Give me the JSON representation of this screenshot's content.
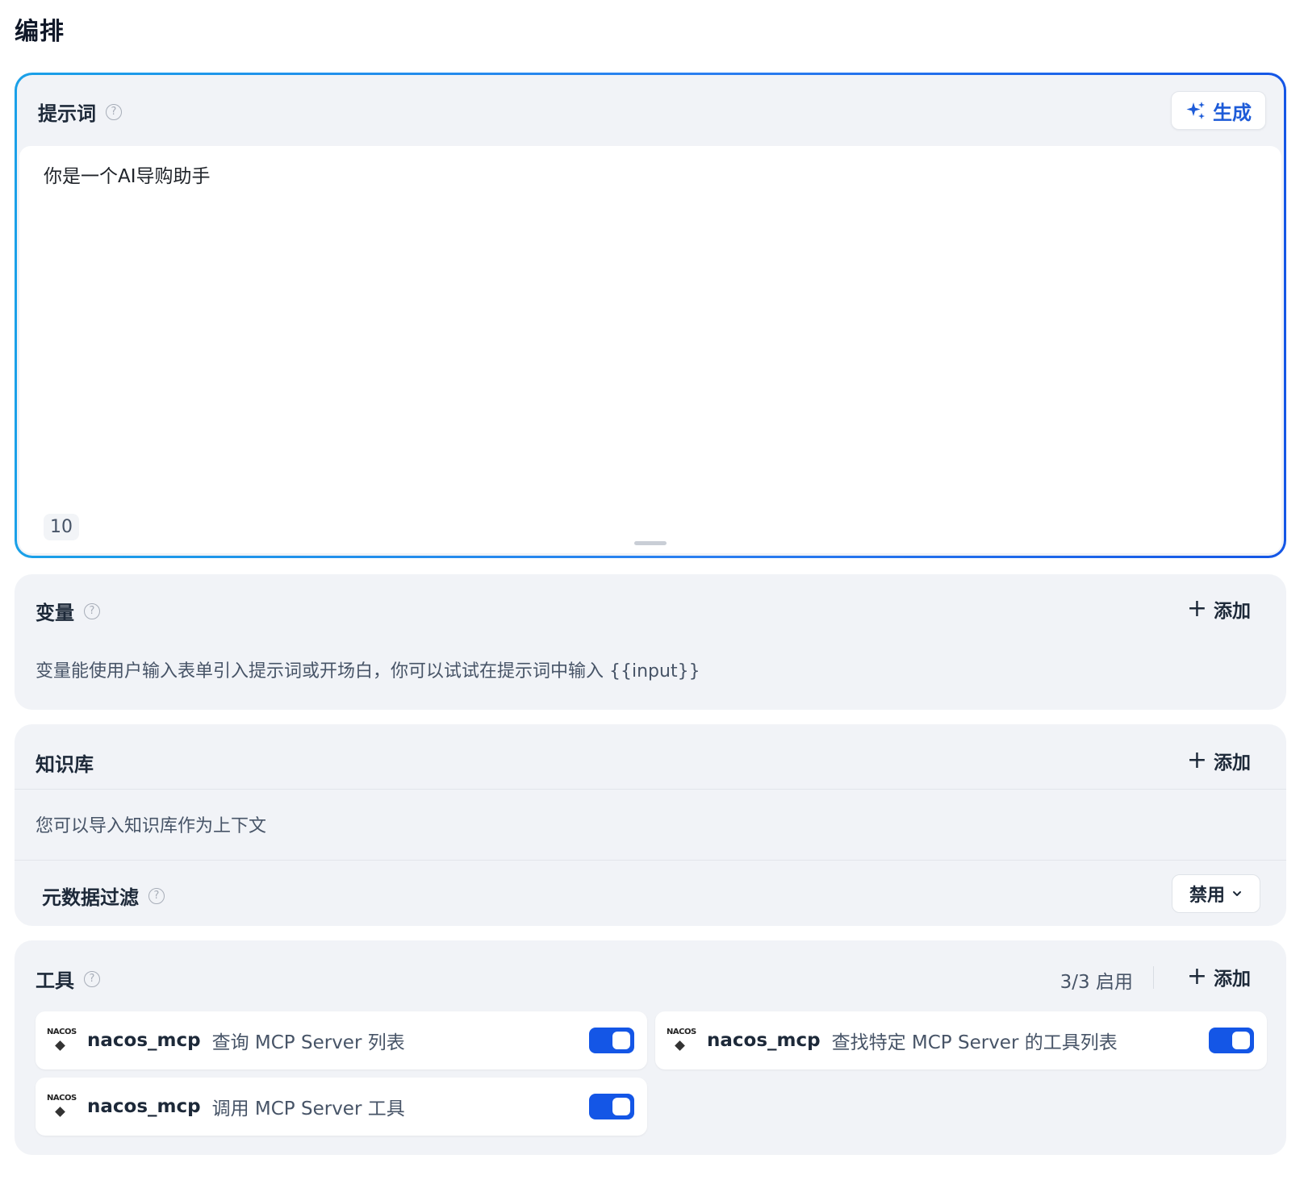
{
  "page": {
    "title": "编排"
  },
  "prompt": {
    "title": "提示词",
    "help_icon": "question-circle-icon",
    "generate_label": "生成",
    "generate_icon": "sparkle-icon",
    "text": "你是一个AI导购助手",
    "char_count": "10",
    "accent_gradient": [
      "#1aa0e8",
      "#1456e6"
    ]
  },
  "variables": {
    "title": "变量",
    "add_label": "添加",
    "description": "变量能使用户输入表单引入提示词或开场白，你可以试试在提示词中输入 {{input}}"
  },
  "knowledge": {
    "title": "知识库",
    "add_label": "添加",
    "description": "您可以导入知识库作为上下文",
    "metadata_filter": {
      "title": "元数据过滤",
      "selected": "禁用"
    }
  },
  "tools": {
    "title": "工具",
    "enabled_count": "3/3 启用",
    "add_label": "添加",
    "items": [
      {
        "logo_text": "NACOS",
        "name": "nacos_mcp",
        "description": "查询 MCP Server 列表",
        "enabled": true
      },
      {
        "logo_text": "NACOS",
        "name": "nacos_mcp",
        "description": "查找特定 MCP Server 的工具列表",
        "enabled": true
      },
      {
        "logo_text": "NACOS",
        "name": "nacos_mcp",
        "description": "调用 MCP Server 工具",
        "enabled": true
      }
    ]
  },
  "colors": {
    "primary": "#1456e6",
    "card_bg": "#f1f3f7",
    "text_secondary": "#475467"
  }
}
